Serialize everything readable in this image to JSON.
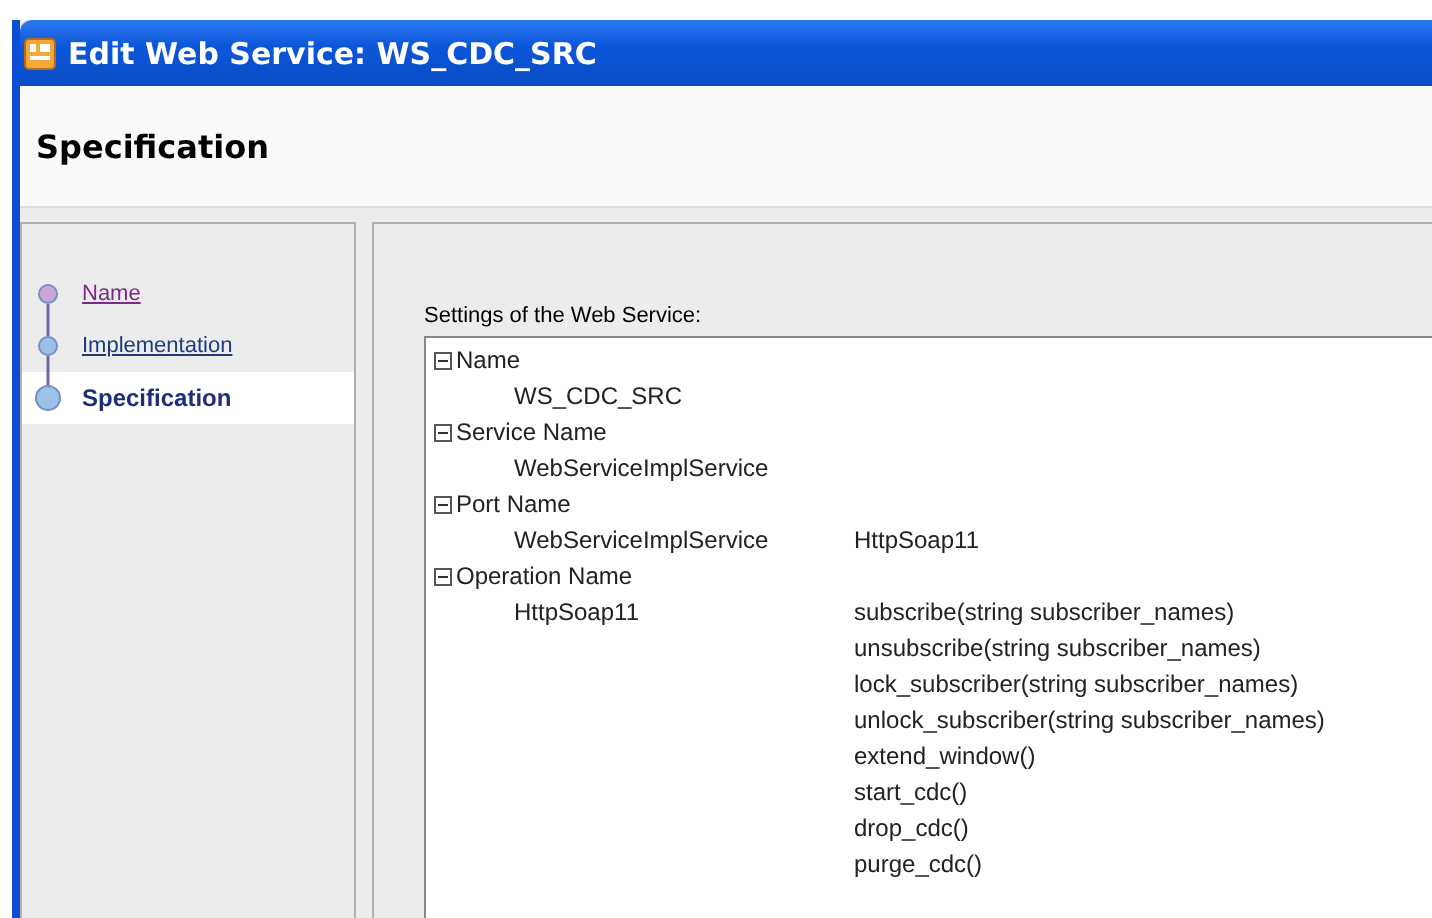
{
  "window": {
    "title": "Edit Web Service: WS_CDC_SRC"
  },
  "header": {
    "title": "Specification"
  },
  "steps": [
    {
      "label": "Name",
      "kind": "visited",
      "selected": false
    },
    {
      "label": "Implementation",
      "kind": "link",
      "selected": false
    },
    {
      "label": "Specification",
      "kind": "current",
      "selected": true
    }
  ],
  "settings": {
    "label": "Settings of the Web Service:",
    "nodes": [
      {
        "label": "Name",
        "expanded": true,
        "entries": [
          {
            "name": "WS_CDC_SRC"
          }
        ]
      },
      {
        "label": "Service Name",
        "expanded": true,
        "entries": [
          {
            "name": "WebServiceImplService"
          }
        ]
      },
      {
        "label": "Port Name",
        "expanded": true,
        "entries": [
          {
            "name": "WebServiceImplService",
            "details": [
              "HttpSoap11"
            ]
          }
        ]
      },
      {
        "label": "Operation Name",
        "expanded": true,
        "entries": [
          {
            "name": "HttpSoap11",
            "details": [
              "subscribe(string subscriber_names)",
              "unsubscribe(string subscriber_names)",
              "lock_subscriber(string subscriber_names)",
              "unlock_subscriber(string subscriber_names)",
              "extend_window()",
              "start_cdc()",
              "drop_cdc()",
              "purge_cdc()"
            ]
          }
        ]
      }
    ]
  }
}
